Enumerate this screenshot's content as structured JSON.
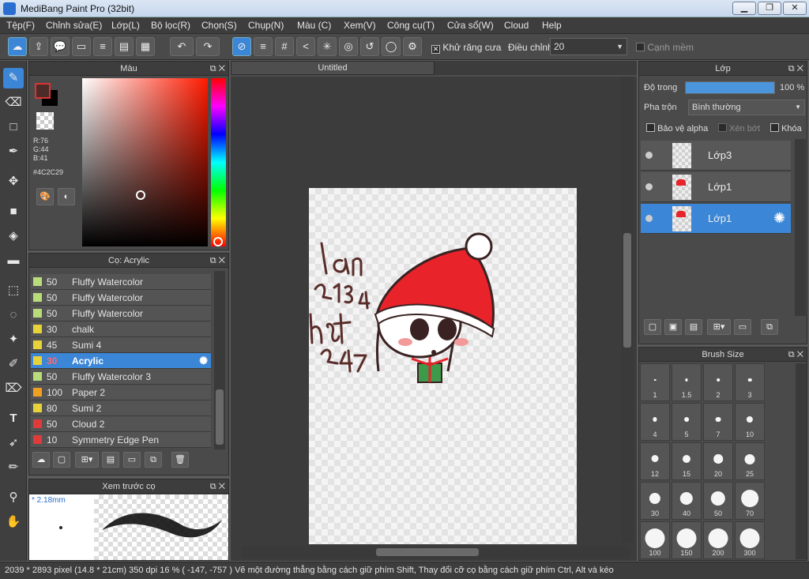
{
  "window": {
    "title": "MediBang Paint Pro (32bit)",
    "min": "▁",
    "max": "❐",
    "close": "✕"
  },
  "menu": [
    "Tệp(F)",
    "Chỉnh sửa(E)",
    "Lớp(L)",
    "Bộ lọc(R)",
    "Chọn(S)",
    "Chụp(N)",
    "Màu (C)",
    "Xem(V)",
    "Công cụ(T)",
    "Cửa sổ(W)",
    "Cloud",
    "Help"
  ],
  "toolbar": {
    "antialias_label": "Khử răng cưa",
    "correction_label": "Điều chỉnh",
    "correction_value": "20",
    "soft_edge_label": "Cạnh mềm"
  },
  "color_panel": {
    "title": "Màu",
    "r": "R:76",
    "g": "G:44",
    "b": "B:41",
    "hex": "#4C2C29",
    "fg_color": "#4c2c29"
  },
  "brush_panel": {
    "title": "Cọ: Acrylic",
    "items": [
      {
        "size": "50",
        "name": "Fluffy Watercolor",
        "color": "#b9dc7a"
      },
      {
        "size": "50",
        "name": "Fluffy Watercolor",
        "color": "#b9dc7a"
      },
      {
        "size": "50",
        "name": "Fluffy Watercolor",
        "color": "#b9dc7a"
      },
      {
        "size": "30",
        "name": "chalk",
        "color": "#e8d23a"
      },
      {
        "size": "45",
        "name": "Sumi 4",
        "color": "#e8d23a"
      },
      {
        "size": "30",
        "name": "Acrylic",
        "color": "#e8d23a",
        "selected": true
      },
      {
        "size": "50",
        "name": "Fluffy Watercolor 3",
        "color": "#b9dc7a"
      },
      {
        "size": "100",
        "name": "Paper 2",
        "color": "#f0a020"
      },
      {
        "size": "80",
        "name": "Sumi 2",
        "color": "#e8d23a"
      },
      {
        "size": "50",
        "name": "Cloud 2",
        "color": "#e03a3a"
      },
      {
        "size": "10",
        "name": "Symmetry Edge Pen",
        "color": "#e03a3a"
      }
    ]
  },
  "preview_panel": {
    "title": "Xem trước cọ",
    "size": "* 2.18mm"
  },
  "canvas": {
    "tab": "Untitled"
  },
  "layer_panel": {
    "title": "Lớp",
    "opacity_label": "Độ trong",
    "opacity_value": "100 %",
    "opacity": 1.0,
    "blend_label": "Pha trộn",
    "blend_value": "Bình thường",
    "protect_alpha": "Bảo vệ alpha",
    "clipping": "Xén bớt",
    "lock": "Khóa",
    "layers": [
      {
        "name": "Lớp3",
        "selected": false
      },
      {
        "name": "Lớp1",
        "selected": false
      },
      {
        "name": "Lớp1",
        "selected": true
      }
    ]
  },
  "size_panel": {
    "title": "Brush Size",
    "sizes": [
      "1",
      "1.5",
      "2",
      "3",
      "4",
      "5",
      "7",
      "10",
      "12",
      "15",
      "20",
      "25",
      "30",
      "40",
      "50",
      "70",
      "100",
      "150",
      "200",
      "300"
    ]
  },
  "status": "2039 * 2893 pixel   (14.8 * 21cm)   350 dpi   16 %   ( -147, -757 )   Vẽ một đường thẳng bằng cách giữ phím Shift, Thay đổi cỡ cọ bằng cách giữ phím Ctrl, Alt và kéo"
}
